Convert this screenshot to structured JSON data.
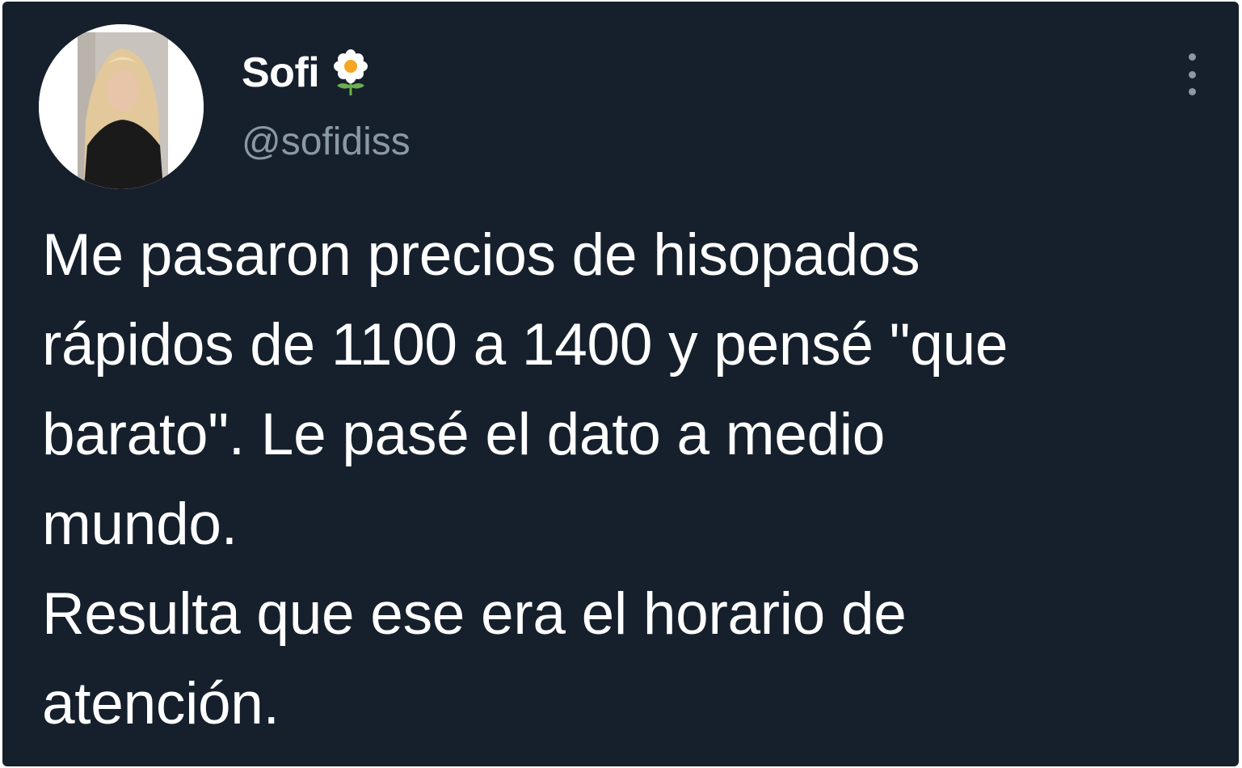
{
  "tweet": {
    "author": {
      "display_name": "Sofi",
      "handle": "@sofidiss",
      "name_emoji_icon": "flower-icon",
      "avatar_icon": "profile-photo"
    },
    "more_options_icon": "vertical-ellipsis-icon",
    "lines": [
      "Me pasaron precios de hisopados",
      "rápidos de 1100 a 1400 y pensé \"que",
      "barato\". Le pasé el dato a medio",
      "mundo.",
      "Resulta que ese era el horario de",
      "atención."
    ]
  },
  "colors": {
    "background": "#16202c",
    "text_primary": "#ffffff",
    "text_secondary": "#8b98a5"
  }
}
